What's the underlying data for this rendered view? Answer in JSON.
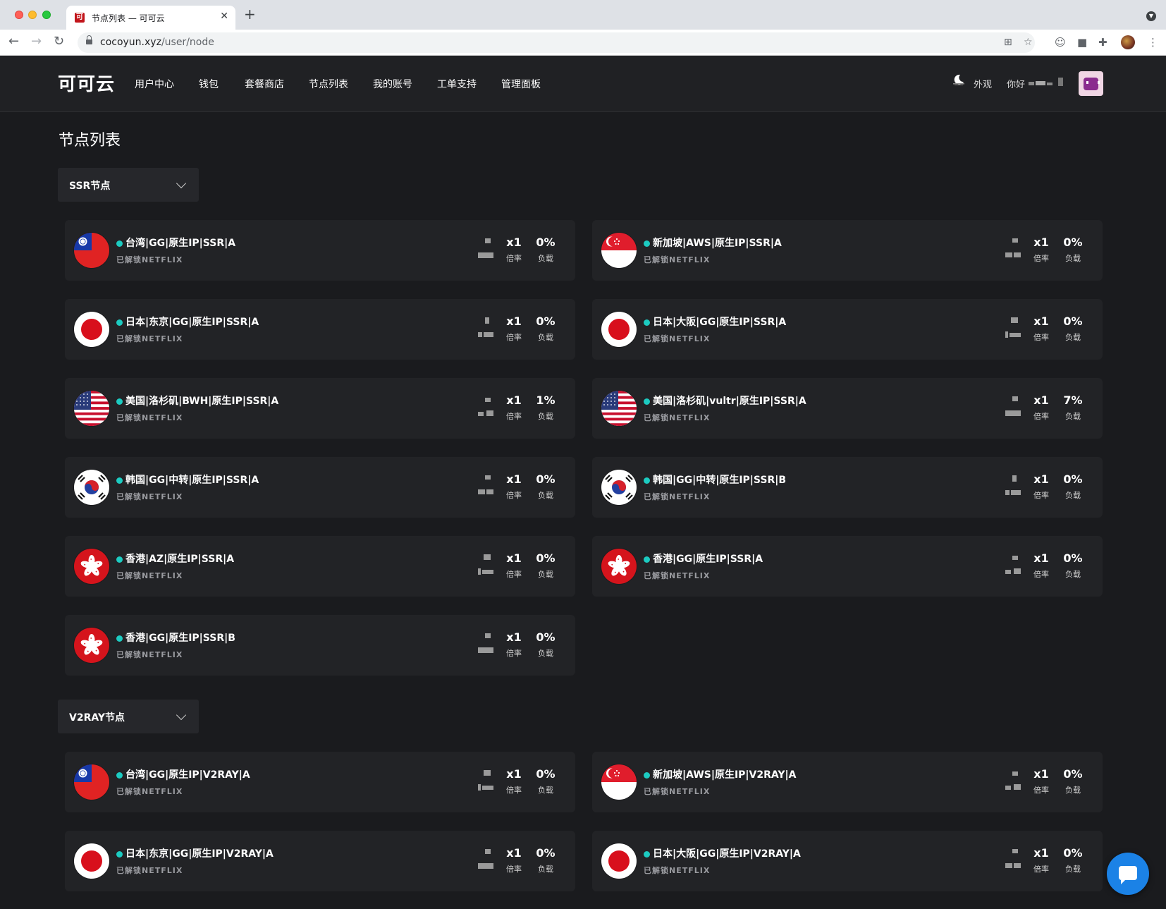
{
  "browser": {
    "tab_title": "节点列表 — 可可云",
    "tab_favicon": "可",
    "url_host": "cocoyun.xyz",
    "url_path": "/user/node",
    "new_tab": "+",
    "close_tab": "✕"
  },
  "header": {
    "logo": "可可云",
    "nav": [
      "用户中心",
      "钱包",
      "套餐商店",
      "节点列表",
      "我的账号",
      "工单支持",
      "管理面板"
    ],
    "appearance": "外观",
    "greeting": "你好"
  },
  "page": {
    "title": "节点列表"
  },
  "groups": [
    {
      "label": "SSR节点",
      "nodes": [
        {
          "name": "台湾|GG|原生IP|SSR|A",
          "tag": "已解锁NETFLIX",
          "flag": "taiwan-flag",
          "multiplier": "x1",
          "multiplier_label": "倍率",
          "load": "0%",
          "load_label": "负载"
        },
        {
          "name": "新加坡|AWS|原生IP|SSR|A",
          "tag": "已解锁NETFLIX",
          "flag": "singapore-flag",
          "multiplier": "x1",
          "multiplier_label": "倍率",
          "load": "0%",
          "load_label": "负载"
        },
        {
          "name": "日本|东京|GG|原生IP|SSR|A",
          "tag": "已解锁NETFLIX",
          "flag": "japan-flag",
          "multiplier": "x1",
          "multiplier_label": "倍率",
          "load": "0%",
          "load_label": "负载"
        },
        {
          "name": "日本|大阪|GG|原生IP|SSR|A",
          "tag": "已解锁NETFLIX",
          "flag": "japan-flag",
          "multiplier": "x1",
          "multiplier_label": "倍率",
          "load": "0%",
          "load_label": "负载"
        },
        {
          "name": "美国|洛杉矶|BWH|原生IP|SSR|A",
          "tag": "已解锁NETFLIX",
          "flag": "usa-flag",
          "multiplier": "x1",
          "multiplier_label": "倍率",
          "load": "1%",
          "load_label": "负载"
        },
        {
          "name": "美国|洛杉矶|vultr|原生IP|SSR|A",
          "tag": "已解锁NETFLIX",
          "flag": "usa-flag",
          "multiplier": "x1",
          "multiplier_label": "倍率",
          "load": "7%",
          "load_label": "负载"
        },
        {
          "name": "韩国|GG|中转|原生IP|SSR|A",
          "tag": "已解锁NETFLIX",
          "flag": "korea-flag",
          "multiplier": "x1",
          "multiplier_label": "倍率",
          "load": "0%",
          "load_label": "负载"
        },
        {
          "name": "韩国|GG|中转|原生IP|SSR|B",
          "tag": "已解锁NETFLIX",
          "flag": "korea-flag",
          "multiplier": "x1",
          "multiplier_label": "倍率",
          "load": "0%",
          "load_label": "负载"
        },
        {
          "name": "香港|AZ|原生IP|SSR|A",
          "tag": "已解锁NETFLIX",
          "flag": "hongkong-flag",
          "multiplier": "x1",
          "multiplier_label": "倍率",
          "load": "0%",
          "load_label": "负载"
        },
        {
          "name": "香港|GG|原生IP|SSR|A",
          "tag": "已解锁NETFLIX",
          "flag": "hongkong-flag",
          "multiplier": "x1",
          "multiplier_label": "倍率",
          "load": "0%",
          "load_label": "负载"
        },
        {
          "name": "香港|GG|原生IP|SSR|B",
          "tag": "已解锁NETFLIX",
          "flag": "hongkong-flag",
          "multiplier": "x1",
          "multiplier_label": "倍率",
          "load": "0%",
          "load_label": "负载"
        }
      ]
    },
    {
      "label": "V2RAY节点",
      "nodes": [
        {
          "name": "台湾|GG|原生IP|V2RAY|A",
          "tag": "已解锁NETFLIX",
          "flag": "taiwan-flag",
          "multiplier": "x1",
          "multiplier_label": "倍率",
          "load": "0%",
          "load_label": "负载"
        },
        {
          "name": "新加坡|AWS|原生IP|V2RAY|A",
          "tag": "已解锁NETFLIX",
          "flag": "singapore-flag",
          "multiplier": "x1",
          "multiplier_label": "倍率",
          "load": "0%",
          "load_label": "负载"
        },
        {
          "name": "日本|东京|GG|原生IP|V2RAY|A",
          "tag": "已解锁NETFLIX",
          "flag": "japan-flag",
          "multiplier": "x1",
          "multiplier_label": "倍率",
          "load": "0%",
          "load_label": "负载"
        },
        {
          "name": "日本|大阪|GG|原生IP|V2RAY|A",
          "tag": "已解锁NETFLIX",
          "flag": "japan-flag",
          "multiplier": "x1",
          "multiplier_label": "倍率",
          "load": "0%",
          "load_label": "负载"
        }
      ]
    }
  ],
  "colors": {
    "status_online": "#1ccbc1",
    "card_bg": "#222326",
    "page_bg": "#1a1b1e",
    "chat_button": "#1b82e6"
  },
  "icons": {
    "chat": "chat-bubble-icon",
    "appearance": "moon-icon",
    "group_toggle": "chevron-down-icon"
  }
}
